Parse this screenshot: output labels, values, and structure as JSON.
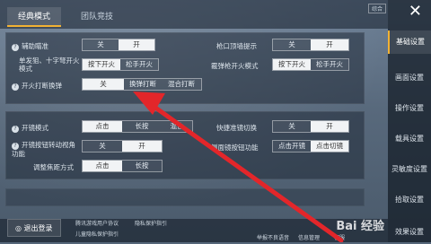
{
  "tabs": [
    "经典模式",
    "团队竞技"
  ],
  "badge": "综合",
  "side": [
    "基础设置",
    "画面设置",
    "操作设置",
    "载具设置",
    "灵敏度设置",
    "拾取设置",
    "效果设置"
  ],
  "panel1": {
    "rows": [
      {
        "label": "辅助瞄准",
        "options": [
          "关",
          "开"
        ],
        "selected": 1
      },
      {
        "label": "枪口顶墙提示",
        "options": [
          "关",
          "开"
        ],
        "selected": 1
      },
      {
        "label": "单发狙、十字弩开火模式",
        "options": [
          "按下开火",
          "松手开火"
        ],
        "selected": 0
      },
      {
        "label": "霰弹枪开火模式",
        "options": [
          "按下开火",
          "松手开火"
        ],
        "selected": 0
      },
      {
        "label": "开火打断换弹",
        "options": [
          "关",
          "换弹打断",
          "混合打断"
        ],
        "selected": 0
      }
    ]
  },
  "panel2": {
    "rows": [
      {
        "label": "开镜模式",
        "options": [
          "点击",
          "长按",
          "混合"
        ],
        "selected": 0
      },
      {
        "label": "快捷准镜切换",
        "options": [
          "关",
          "开"
        ],
        "selected": 1
      },
      {
        "label": "开镜按钮转动视角功能",
        "options": [
          "关",
          "开"
        ],
        "selected": 1
      },
      {
        "label": "侧面镜按钮功能",
        "options": [
          "点击开镜",
          "点击切镜"
        ],
        "selected": 1
      },
      {
        "label": "调整焦距方式",
        "options": [
          "点击",
          "长按"
        ],
        "selected": 0
      }
    ]
  },
  "bottom": {
    "logout": "退出登录",
    "links": [
      "腾讯游戏用户协议",
      "隐私保护指引",
      "儿童隐私保护指引"
    ],
    "btns": [
      "举报不良语音",
      "信息管理",
      "客服"
    ]
  },
  "watermark": "Bai 经验",
  "close": "✕",
  "question": "?"
}
